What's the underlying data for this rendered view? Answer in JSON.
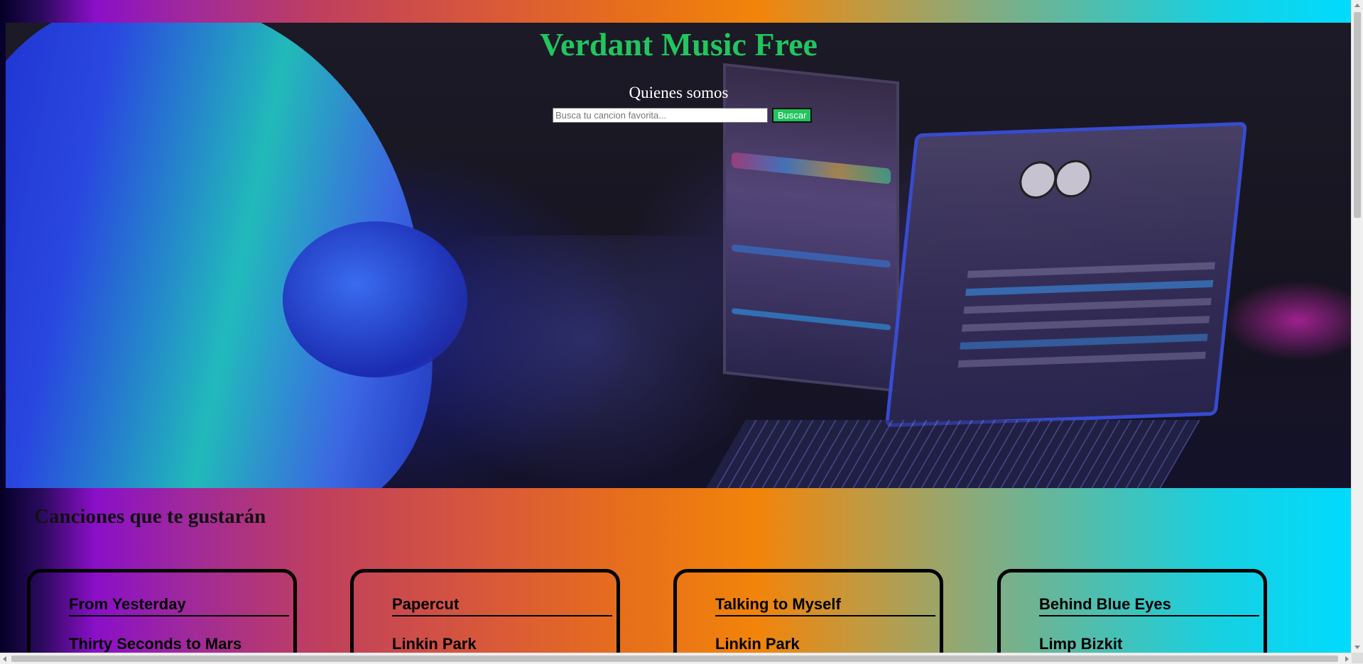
{
  "site": {
    "title": "Verdant Music Free",
    "about_link": "Quienes somos"
  },
  "search": {
    "placeholder": "Busca tu cancion favorita...",
    "value": "",
    "button_label": "Buscar"
  },
  "section": {
    "title": "Canciones que te gustarán"
  },
  "songs": [
    {
      "title": "From Yesterday",
      "artist": "Thirty Seconds to Mars"
    },
    {
      "title": "Papercut",
      "artist": "Linkin Park"
    },
    {
      "title": "Talking to Myself",
      "artist": "Linkin Park"
    },
    {
      "title": "Behind Blue Eyes",
      "artist": "Limp Bizkit"
    }
  ],
  "colors": {
    "title_green": "#22c55e",
    "button_green": "#22c55e",
    "card_border": "#000000"
  },
  "icons": {
    "hero_image": "dj-laptops-photo"
  }
}
